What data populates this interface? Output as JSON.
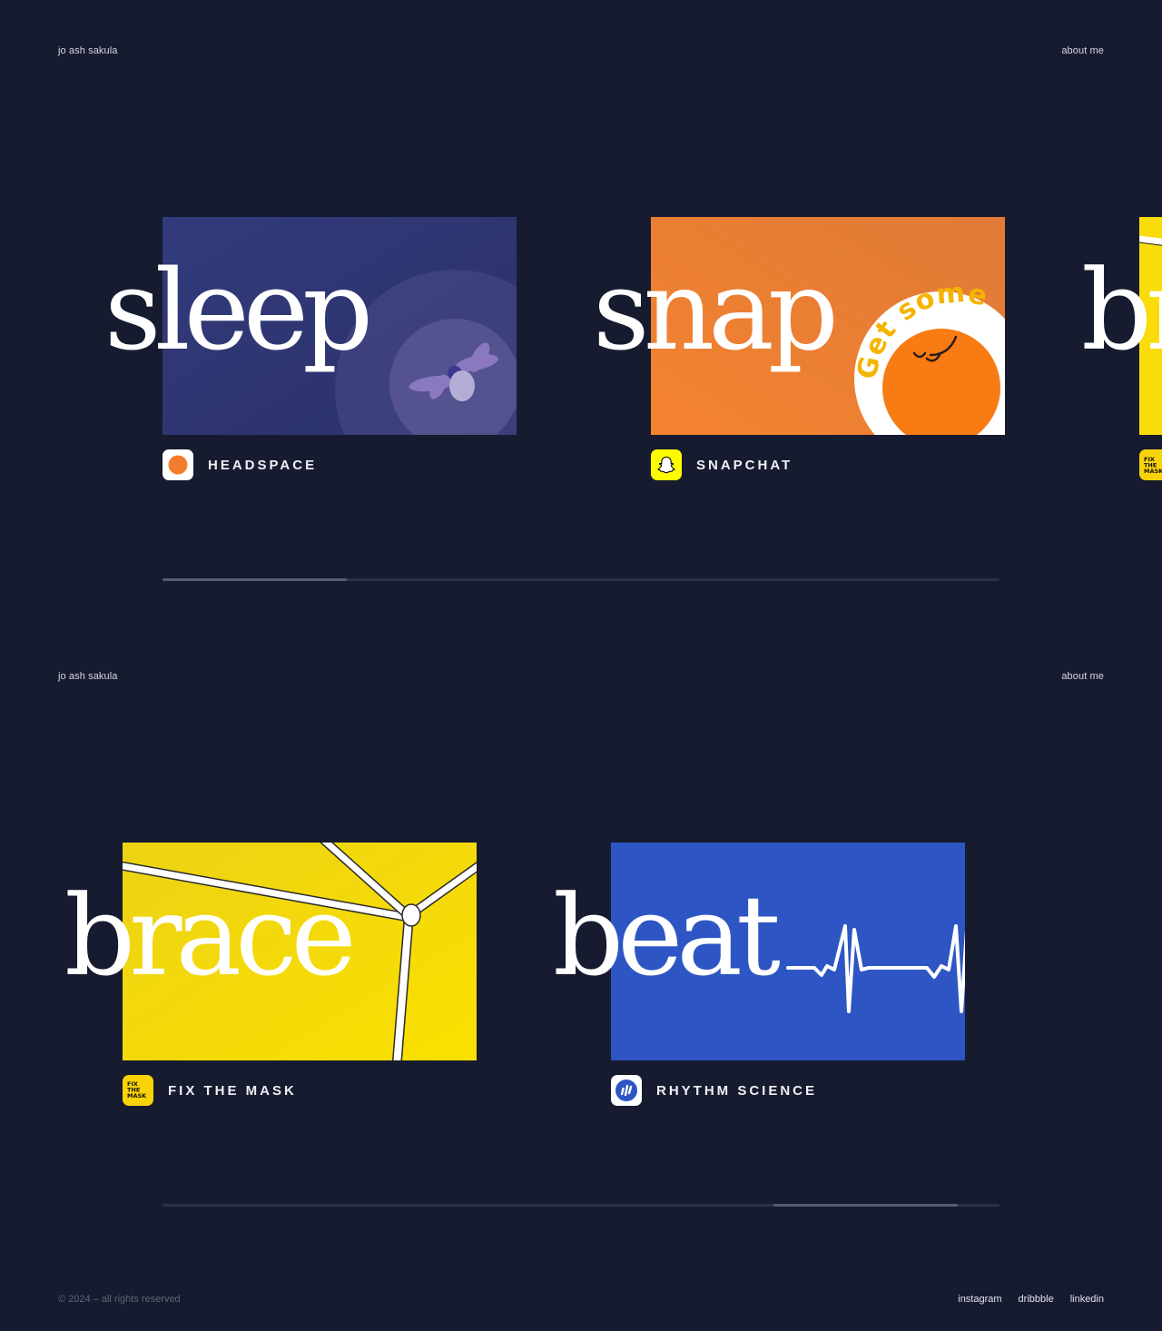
{
  "site": {
    "name": "jo ash sakula",
    "about_label": "about me"
  },
  "slider_1": {
    "cards": [
      {
        "word": "sleep",
        "label": "HEADSPACE",
        "logo_icon": "headspace-logo-icon",
        "image_color": "#2d3470"
      },
      {
        "word": "snap",
        "label": "SNAPCHAT",
        "logo_icon": "snapchat-ghost-icon",
        "image_color": "#f07f2f",
        "sticker_text": "Get some"
      },
      {
        "word": "br",
        "logo_icon": "fix-the-mask-logo-icon",
        "image_color": "#f9dc0a",
        "logo_text": "FIX THE MASK"
      }
    ],
    "progress": {
      "start": 0,
      "end": 0.22
    }
  },
  "slider_2": {
    "cards": [
      {
        "word": "brace",
        "label": "FIX THE MASK",
        "logo_icon": "fix-the-mask-logo-icon",
        "image_color": "#f7d90e",
        "logo_text": "FIX THE MASK"
      },
      {
        "word": "beat",
        "label": "RHYTHM SCIENCE",
        "logo_icon": "rhythm-science-logo-icon",
        "image_color": "#2d55c3"
      }
    ],
    "progress": {
      "start": 0.73,
      "end": 0.95
    }
  },
  "footer": {
    "copyright": "© 2024 – all rights reserved",
    "links": [
      "instagram",
      "dribbble",
      "linkedin"
    ]
  },
  "colors": {
    "background": "#171b2f",
    "headspace": "#2d3470",
    "snapchat": "#f07f2f",
    "fix_the_mask": "#f9dc0a",
    "rhythm_science": "#2d55c3"
  }
}
